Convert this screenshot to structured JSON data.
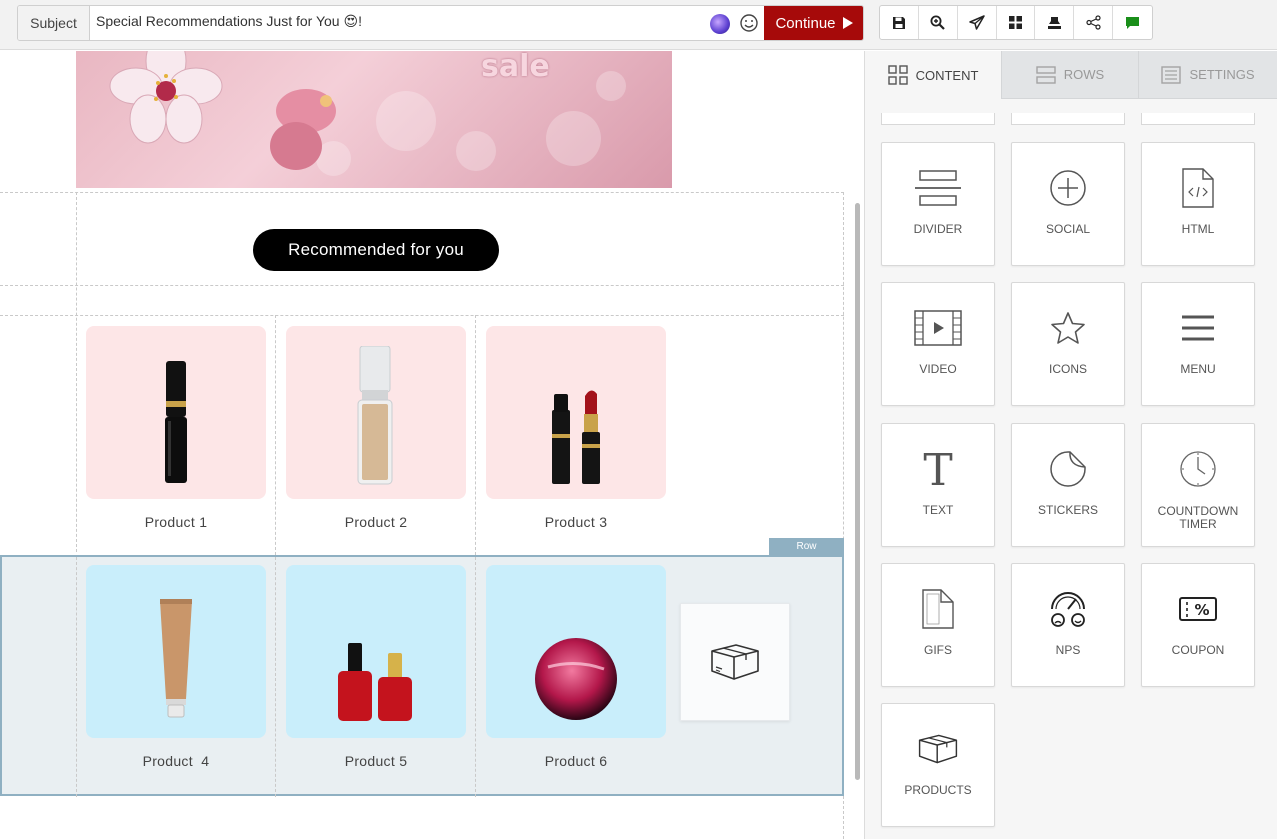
{
  "topbar": {
    "subject_label": "Subject",
    "subject_value": "Special Recommendations Just for You 😍!",
    "continue_label": "Continue",
    "toolbar_icons": [
      "save-icon",
      "zoom-in-icon",
      "send-icon",
      "layout-icon",
      "stamp-icon",
      "share-icon",
      "chat-icon"
    ]
  },
  "canvas": {
    "banner_text": "sale",
    "recommend_button": "Recommended for you",
    "row_tag": "Row",
    "products": [
      {
        "label": "Product 1",
        "item": "mascara"
      },
      {
        "label": "Product 2",
        "item": "foundation"
      },
      {
        "label": "Product 3",
        "item": "lipsticks"
      },
      {
        "label": "Product  4",
        "item": "cream-tube"
      },
      {
        "label": "Product 5",
        "item": "nail-polish"
      },
      {
        "label": "Product 6",
        "item": "sphere"
      }
    ]
  },
  "panel": {
    "tabs": [
      {
        "label": "CONTENT",
        "icon": "grid-icon",
        "active": true
      },
      {
        "label": "ROWS",
        "icon": "rows-icon",
        "active": false
      },
      {
        "label": "SETTINGS",
        "icon": "settings-icon",
        "active": false
      }
    ],
    "tiles": [
      {
        "label": "DIVIDER",
        "icon": "divider-icon"
      },
      {
        "label": "SOCIAL",
        "icon": "social-plus-icon"
      },
      {
        "label": "HTML",
        "icon": "html-file-icon"
      },
      {
        "label": "VIDEO",
        "icon": "video-icon"
      },
      {
        "label": "ICONS",
        "icon": "star-icon"
      },
      {
        "label": "MENU",
        "icon": "hamburger-icon"
      },
      {
        "label": "TEXT",
        "icon": "text-t-icon"
      },
      {
        "label": "STICKERS",
        "icon": "sticker-icon"
      },
      {
        "label": "COUNTDOWN TIMER",
        "icon": "clock-icon"
      },
      {
        "label": "GIFS",
        "icon": "gif-file-icon"
      },
      {
        "label": "NPS",
        "icon": "nps-gauge-icon"
      },
      {
        "label": "COUPON",
        "icon": "coupon-icon"
      },
      {
        "label": "PRODUCTS",
        "icon": "box-icon"
      }
    ]
  },
  "colors": {
    "continue_bg": "#a60a0a",
    "row_selection": "#8fb0c2",
    "pink_card": "#fde6e7",
    "blue_card": "#c9eefb",
    "chat_green": "#1a8f1a"
  }
}
